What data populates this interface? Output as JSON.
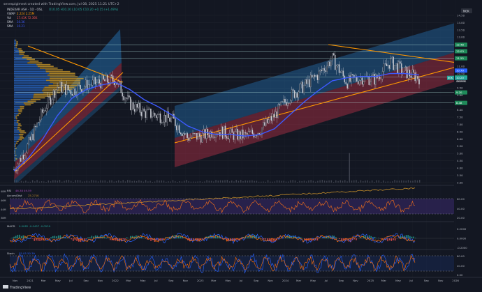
{
  "header": {
    "created_line": "sevespiglmest created with TradingView.com, Jul 08, 2025 11:21 UTC+2",
    "symbol_line": "INDEXAR ASA · 1D · OSL",
    "ohlc_line": "O10.05 H10.20 L10.05 C10.20 +0.15 (+1.49%)",
    "vwap_label": "VWAP",
    "vwap_values": "2.224  2.25M",
    "vol_label": "Vol",
    "vol_values": "17.41K  72.36K",
    "sma1_label": "SMA",
    "sma1_value": "10.36",
    "sma2_label": "SMA",
    "sma2_value": "10.21"
  },
  "currency": "NOK",
  "price_axis": {
    "ticks": [
      "14.50",
      "14.00",
      "13.50",
      "13.00",
      "12.50",
      "12.00",
      "11.50",
      "11.00",
      "10.50",
      "10.00",
      "9.50",
      "9.00",
      "8.50",
      "8.00",
      "7.50",
      "7.00",
      "6.50",
      "6.00",
      "5.50",
      "5.00",
      "4.50",
      "4.00",
      "3.50",
      "3.00"
    ],
    "badges": [
      {
        "text": "12.48",
        "value": 12.48,
        "color": "#1f8a5a"
      },
      {
        "text": "12.03",
        "value": 12.03,
        "color": "#1f8a5a"
      },
      {
        "text": "11.55",
        "value": 11.55,
        "color": "#1f8a5a"
      },
      {
        "text": "10.70",
        "value": 10.7,
        "color": "#2962ff"
      },
      {
        "text": "10.25",
        "value": 10.25,
        "color": "#1f8a5a"
      },
      {
        "text": "10.20",
        "value": 10.2,
        "color": "#26a69a"
      },
      {
        "text": "9.20",
        "value": 9.2,
        "color": "#1f8a5a"
      },
      {
        "text": "8.48",
        "value": 8.48,
        "color": "#1f8a5a"
      }
    ],
    "last_tag": "NOK",
    "last_price": "10.20",
    "countdown": "09:09:40"
  },
  "x_axis": {
    "labels": [
      "Nov",
      "2021",
      "Mar",
      "May",
      "Jul",
      "Sep",
      "Nov",
      "2022",
      "Mar",
      "May",
      "Jul",
      "Sep",
      "Nov",
      "2023",
      "Mar",
      "May",
      "Jul",
      "Sep",
      "Nov",
      "2024",
      "Mar",
      "May",
      "Jul",
      "Sep",
      "Nov",
      "2025",
      "Mar",
      "May",
      "Jul",
      "Sep",
      "Nov",
      "2026"
    ]
  },
  "rsi_panel": {
    "title": "RSI",
    "values_text": "46.38  49.59",
    "sub_title": "Accum/Dist",
    "sub_value": "25.271K",
    "left_top": "48M",
    "left_mid": "46M",
    "left_bot": "44M",
    "left_low": "38M",
    "ticks": [
      "60.00",
      "40.00",
      "20.00"
    ]
  },
  "macd_panel": {
    "title": "MACD",
    "values_text": "0.0082  -0.0457  -0.0539",
    "ticks": [
      "0.2000",
      "0.0000",
      "-0.2000"
    ]
  },
  "stoch_panel": {
    "title": "Stoch",
    "values_text": "55.05  50.39",
    "ticks": [
      "80.00",
      "40.00",
      "0.00"
    ]
  },
  "logo": "TradingView",
  "colors": {
    "background": "#131722",
    "candle": "#c8cbd3",
    "sma": "#3d5afe",
    "fib_line": "#ff9800",
    "channel_blue": "#2a8fe0",
    "channel_red": "#c0334a",
    "rsi_line": "#e0671f",
    "rsi_band": "#3a2a6e",
    "macd": "#2962ff",
    "signal": "#ff6d00",
    "stoch_k": "#2962ff",
    "stoch_d": "#ff6d00"
  },
  "chart_data": {
    "type": "line",
    "title": "INDEXAR ASA · 1D · OSL",
    "xlabel": "",
    "ylabel": "",
    "ylim": [
      3.0,
      14.5
    ],
    "x": [
      "Nov 2020",
      "2021",
      "Mar 2021",
      "May 2021",
      "Jul 2021",
      "Sep 2021",
      "Nov 2021",
      "2022",
      "Mar 2022",
      "May 2022",
      "Jul 2022",
      "Sep 2022",
      "Nov 2022",
      "2023",
      "Mar 2023",
      "May 2023",
      "Jul 2023",
      "Sep 2023",
      "Nov 2023",
      "2024",
      "Mar 2024",
      "May 2024",
      "Jul 2024",
      "Sep 2024",
      "Nov 2024",
      "2025",
      "Mar 2025",
      "May 2025",
      "Jul 2025"
    ],
    "series": [
      {
        "name": "Close",
        "values": [
          3.9,
          5.6,
          7.9,
          9.6,
          9.3,
          9.7,
          9.9,
          10.1,
          8.4,
          7.8,
          7.6,
          7.3,
          6.1,
          6.2,
          6.6,
          6.3,
          6.2,
          6.6,
          7.6,
          8.9,
          9.6,
          10.4,
          11.5,
          9.9,
          10.2,
          10.1,
          11.3,
          10.6,
          10.2
        ]
      },
      {
        "name": "SMA",
        "values": [
          3.8,
          4.7,
          6.0,
          7.6,
          8.8,
          9.4,
          9.7,
          9.9,
          9.4,
          8.7,
          8.2,
          7.6,
          6.9,
          6.5,
          6.3,
          6.3,
          6.2,
          6.3,
          6.7,
          7.6,
          8.5,
          9.3,
          10.0,
          10.2,
          10.3,
          10.3,
          10.5,
          10.5,
          10.4
        ]
      }
    ]
  }
}
